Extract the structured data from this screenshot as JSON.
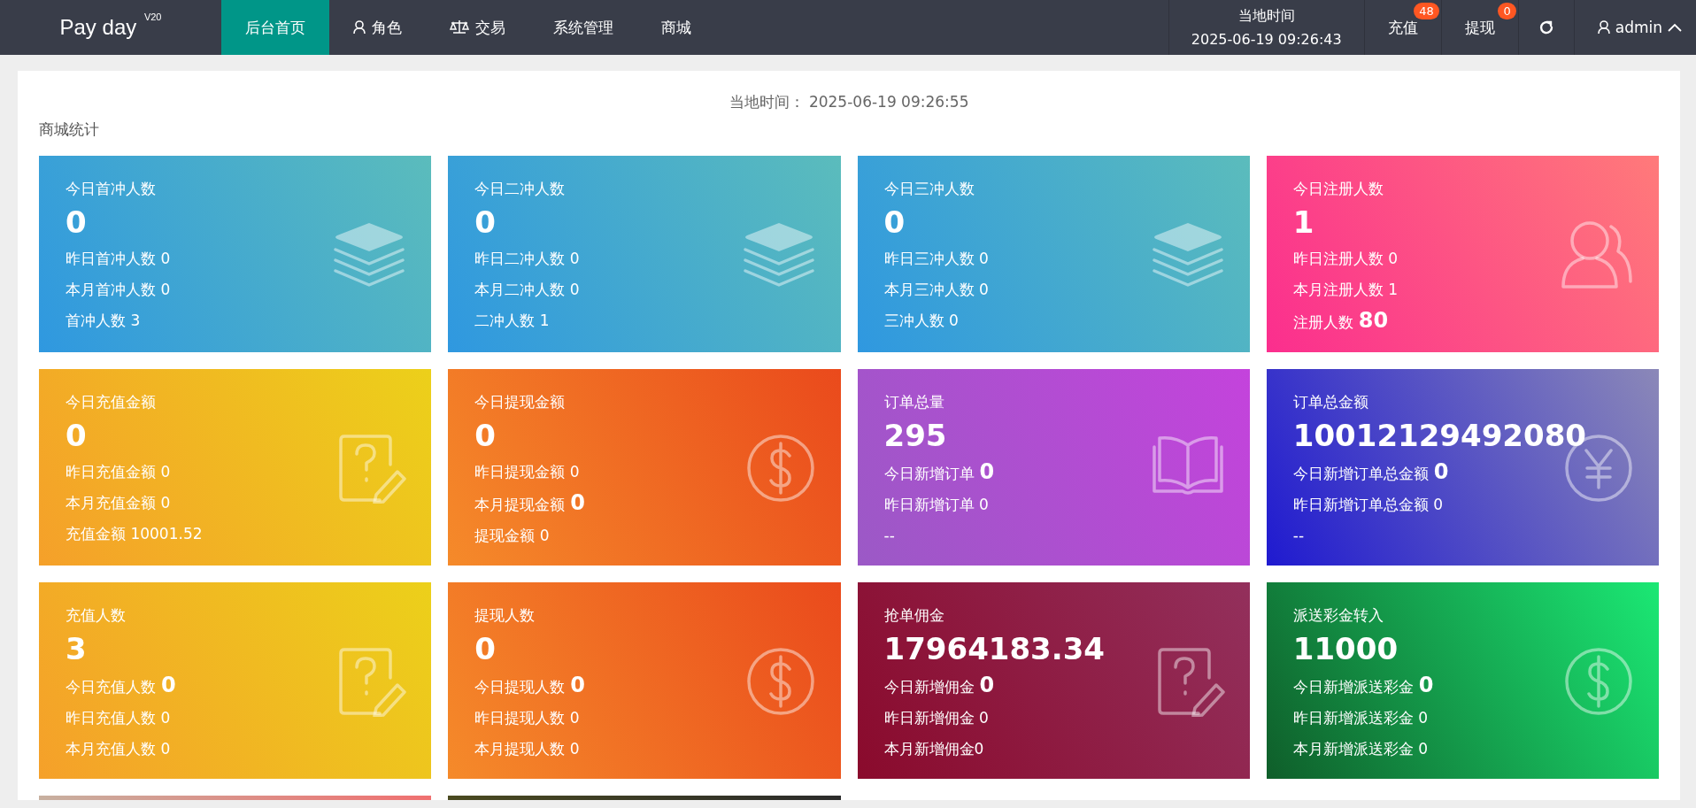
{
  "header": {
    "logo": "Pay day $^{V20}$",
    "nav": [
      {
        "label": "后台首页",
        "selected": true
      },
      {
        "label": "角色",
        "selected": false
      },
      {
        "label": "交易",
        "selected": false
      },
      {
        "label": "系统管理",
        "selected": false
      },
      {
        "label": "商城",
        "selected": false
      }
    ],
    "clock": {
      "label": "当地时间",
      "value": "2025-06-19 09:26:43"
    },
    "actions": [
      {
        "label": "充值",
        "badge": "48"
      },
      {
        "label": "提现",
        "badge": "0"
      }
    ],
    "user": {
      "name": "admin",
      "expanded": true
    }
  },
  "page": {
    "time_label": "当地时间：",
    "time_value": "2025-06-19 09:26:55",
    "section_title": "商城统计"
  },
  "cards": [
    {
      "title": "今日首冲人数",
      "value": "0",
      "lines": [
        {
          "text": "昨日首冲人数 0"
        },
        {
          "text": "本月首冲人数 0"
        },
        {
          "text": "首冲人数 3"
        }
      ]
    },
    {
      "title": "今日二冲人数",
      "value": "0",
      "lines": [
        {
          "text": "昨日二冲人数 0"
        },
        {
          "text": "本月二冲人数 0"
        },
        {
          "text": "二冲人数 1"
        }
      ]
    },
    {
      "title": "今日三冲人数",
      "value": "0",
      "lines": [
        {
          "text": "昨日三冲人数 0"
        },
        {
          "text": "本月三冲人数 0"
        },
        {
          "text": "三冲人数 0"
        }
      ]
    },
    {
      "title": "今日注册人数",
      "value": "1",
      "lines": [
        {
          "text": "昨日注册人数 0"
        },
        {
          "text": "本月注册人数 1"
        },
        {
          "text": "注册人数",
          "emph": "80"
        }
      ]
    },
    {
      "title": "今日充值金额",
      "value": "0",
      "lines": [
        {
          "text": "昨日充值金额 0"
        },
        {
          "text": "本月充值金额 0"
        },
        {
          "text": "充值金额 10001.52"
        }
      ]
    },
    {
      "title": "今日提现金额",
      "value": "0",
      "lines": [
        {
          "text": "昨日提现金额 0"
        },
        {
          "text": "本月提现金额",
          "emph": "0"
        },
        {
          "text": "提现金额 0"
        }
      ]
    },
    {
      "title": "订单总量",
      "value": "295",
      "lines": [
        {
          "text": "今日新增订单",
          "emph": "0"
        },
        {
          "text": "昨日新增订单 0"
        },
        {
          "text": "--"
        }
      ]
    },
    {
      "title": "订单总金额",
      "value": "10012129492080",
      "lines": [
        {
          "text": "今日新增订单总金额",
          "emph": "0"
        },
        {
          "text": "昨日新增订单总金额 0"
        },
        {
          "text": "--"
        }
      ]
    },
    {
      "title": "充值人数",
      "value": "3",
      "lines": [
        {
          "text": "今日充值人数",
          "emph": "0"
        },
        {
          "text": "昨日充值人数 0"
        },
        {
          "text": "本月充值人数 0"
        }
      ]
    },
    {
      "title": "提现人数",
      "value": "0",
      "lines": [
        {
          "text": "今日提现人数",
          "emph": "0"
        },
        {
          "text": "昨日提现人数 0"
        },
        {
          "text": "本月提现人数 0"
        }
      ]
    },
    {
      "title": "抢单佣金",
      "value": "17964183.34",
      "lines": [
        {
          "text": "今日新增佣金",
          "emph": "0"
        },
        {
          "text": "昨日新增佣金 0"
        },
        {
          "text": "本月新增佣金0"
        }
      ]
    },
    {
      "title": "派送彩金转入",
      "value": "11000",
      "lines": [
        {
          "text": "今日新增派送彩金",
          "emph": "0"
        },
        {
          "text": "昨日新增派送彩金 0"
        },
        {
          "text": "本月新增派送彩金 0"
        }
      ]
    }
  ]
}
